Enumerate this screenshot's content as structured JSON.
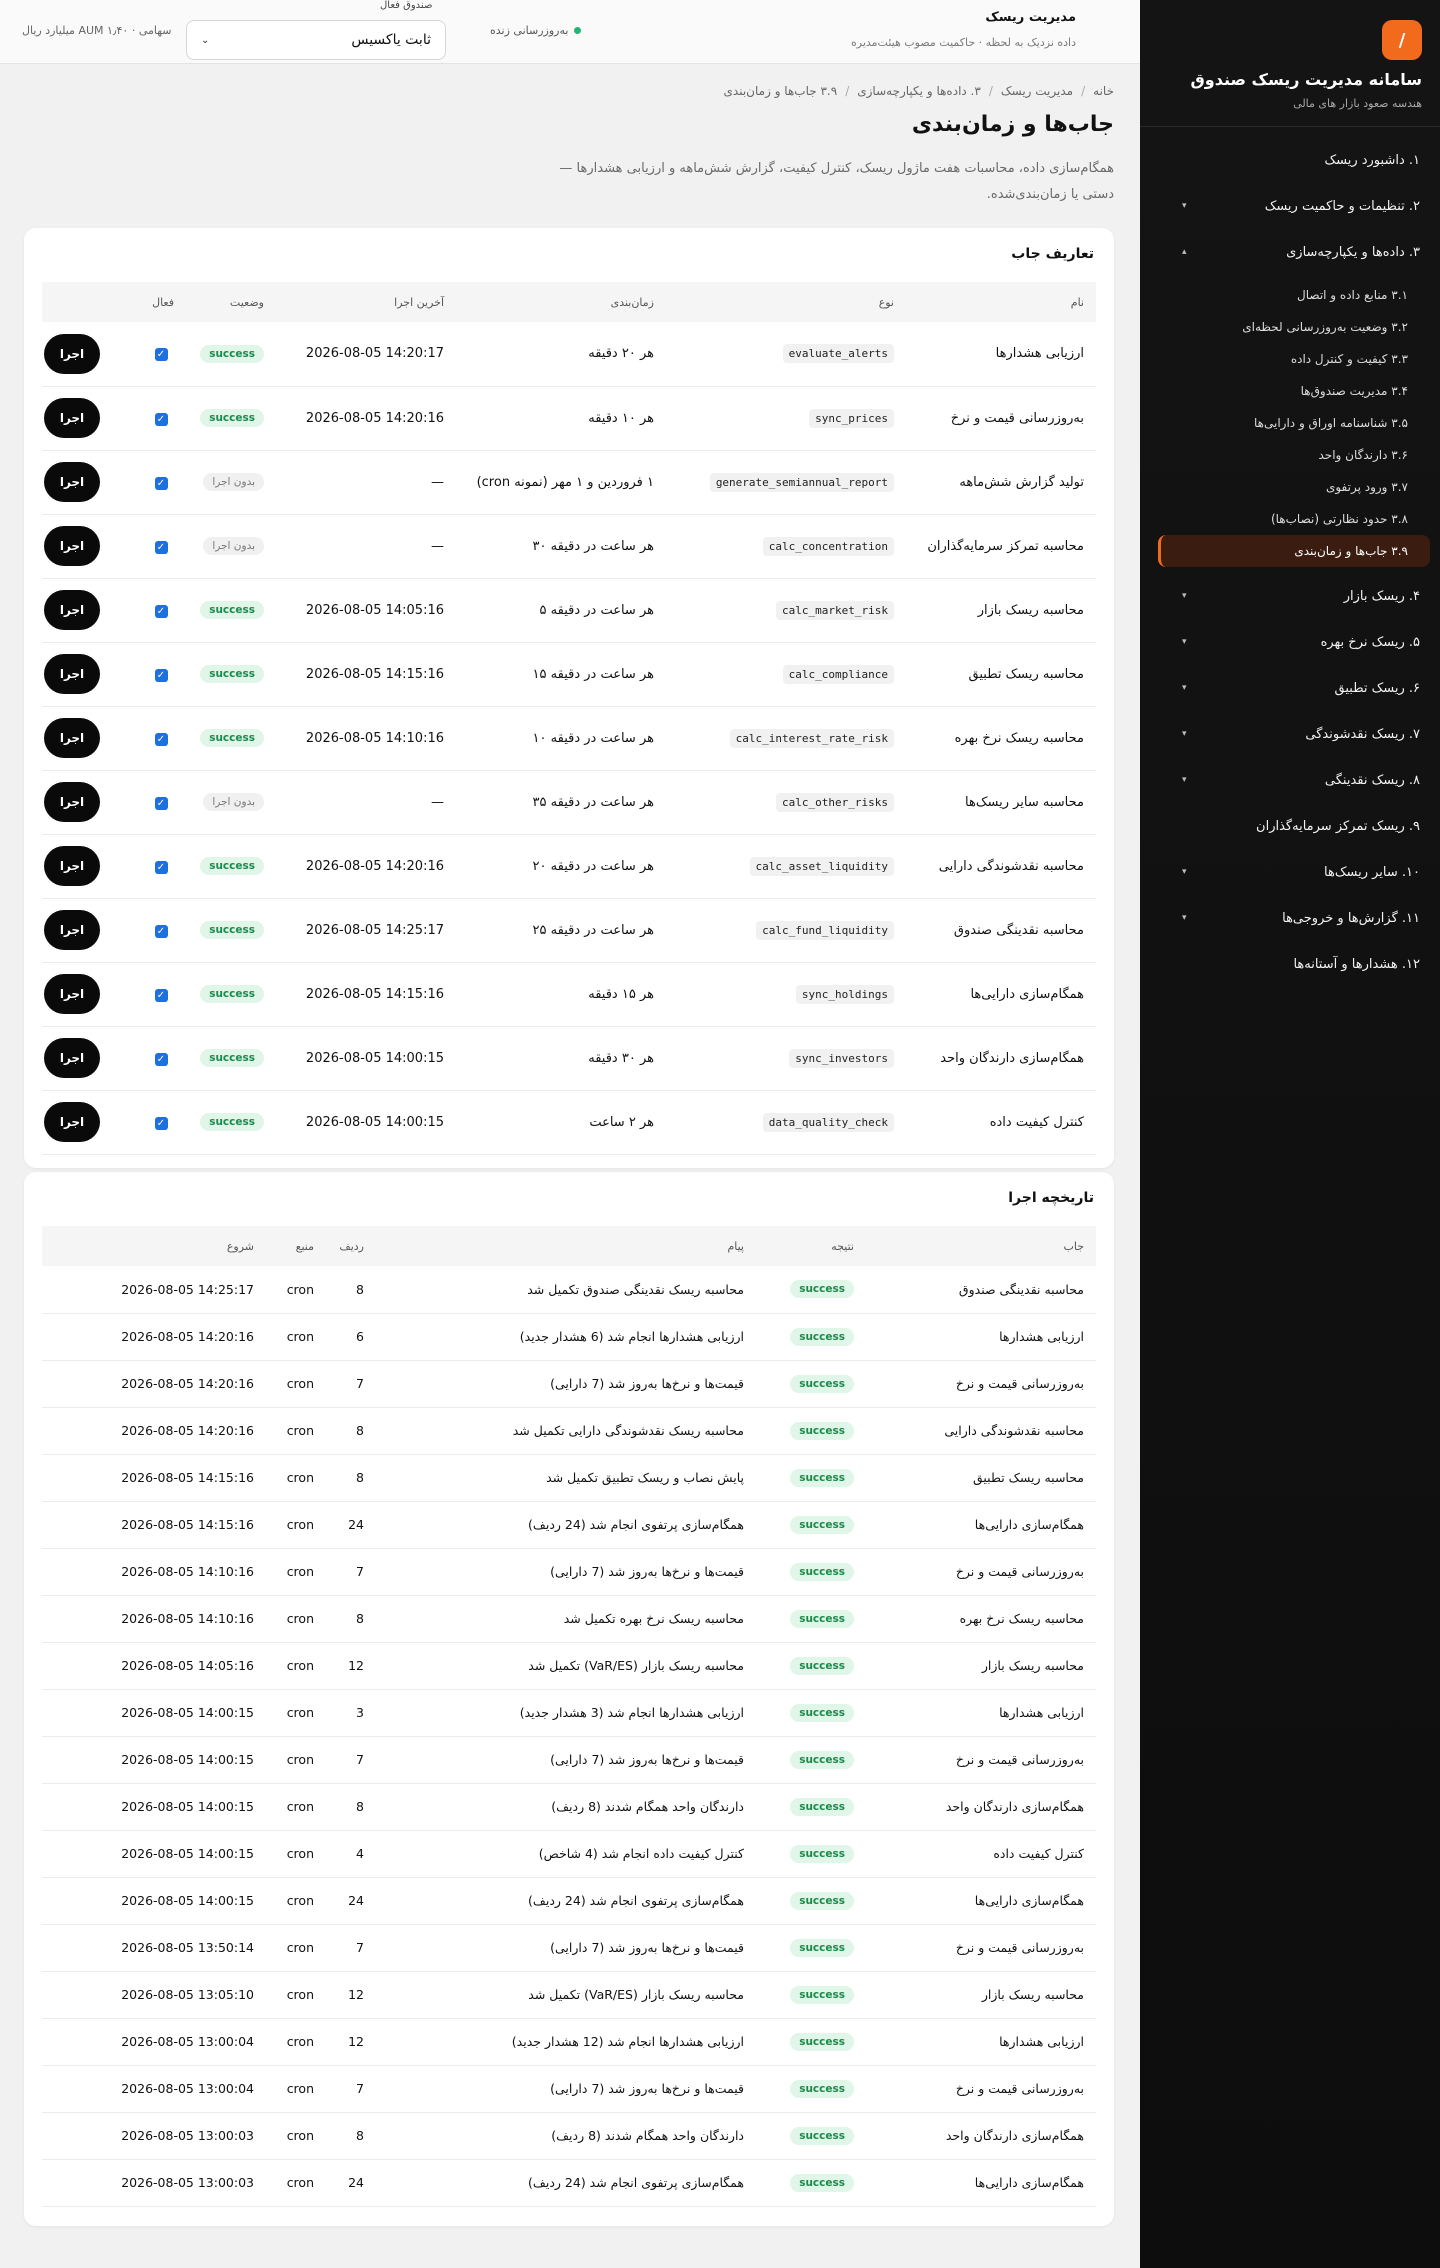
{
  "sidebar": {
    "logo": "/",
    "title": "سامانه مدیریت ریسک صندوق",
    "subtitle": "هندسه صعود بازار های مالی",
    "items": [
      {
        "label": "۱. داشبورد ریسک",
        "chevron": ""
      },
      {
        "label": "۲. تنظیمات و حاکمیت ریسک",
        "chevron": "▾"
      },
      {
        "label": "۳. داده‌ها و یکپارچه‌سازی",
        "chevron": "▴"
      },
      {
        "label": "۴. ریسک بازار",
        "chevron": "▾"
      },
      {
        "label": "۵. ریسک نرخ بهره",
        "chevron": "▾"
      },
      {
        "label": "۶. ریسک تطبیق",
        "chevron": "▾"
      },
      {
        "label": "۷. ریسک نقدشوندگی",
        "chevron": "▾"
      },
      {
        "label": "۸. ریسک نقدینگی",
        "chevron": "▾"
      },
      {
        "label": "۹. ریسک تمرکز سرمایه‌گذاران",
        "chevron": ""
      },
      {
        "label": "۱۰. سایر ریسک‌ها",
        "chevron": "▾"
      },
      {
        "label": "۱۱. گزارش‌ها و خروجی‌ها",
        "chevron": "▾"
      },
      {
        "label": "۱۲. هشدارها و آستانه‌ها",
        "chevron": ""
      }
    ],
    "subitems": [
      "۳.۱ منابع داده و اتصال",
      "۳.۲ وضعیت به‌روزرسانی لحظه‌ای",
      "۳.۳ کیفیت و کنترل داده",
      "۳.۴ مدیریت صندوق‌ها",
      "۳.۵ شناسنامه اوراق و دارایی‌ها",
      "۳.۶ دارندگان واحد",
      "۳.۷ ورود پرتفوی",
      "۳.۸ حدود نظارتی (نصاب‌ها)",
      "۳.۹ جاب‌ها و زمان‌بندی"
    ]
  },
  "topbar": {
    "title": "مدیریت ریسک",
    "subtitle": "داده نزدیک به لحظه · حاکمیت مصوب هیئت‌مدیره",
    "live": "به‌روزرسانی زنده",
    "fund_label": "صندوق فعال",
    "fund_value": "ثابت یاکسیس",
    "aum": "سهامی · AUM ۱٫۴۰ میلیارد ریال"
  },
  "breadcrumb": [
    "خانه",
    "مدیریت ریسک",
    "۳. داده‌ها و یکپارچه‌سازی",
    "۳.۹ جاب‌ها و زمان‌بندی"
  ],
  "page": {
    "title": "جاب‌ها و زمان‌بندی",
    "description": "همگام‌سازی داده، محاسبات هفت ماژول ریسک، کنترل کیفیت، گزارش شش‌ماهه و ارزیابی هشدارها — دستی یا زمان‌بندی‌شده."
  },
  "jobs": {
    "title": "تعاریف جاب",
    "columns": [
      "نام",
      "نوع",
      "زمان‌بندی",
      "آخرین اجرا",
      "وضعیت",
      "فعال"
    ],
    "run_label": "اجرا",
    "rows": [
      {
        "name": "ارزیابی هشدارها",
        "type": "evaluate_alerts",
        "schedule": "هر ۲۰ دقیقه",
        "last": "2026-08-05 14:20:17",
        "status": "success"
      },
      {
        "name": "به‌روزرسانی قیمت و نرخ",
        "type": "sync_prices",
        "schedule": "هر ۱۰ دقیقه",
        "last": "2026-08-05 14:20:16",
        "status": "success"
      },
      {
        "name": "تولید گزارش شش‌ماهه",
        "type": "generate_semiannual_report",
        "schedule": "۱ فروردین و ۱ مهر (نمونه cron)",
        "last": "—",
        "status": "بدون اجرا"
      },
      {
        "name": "محاسبه تمرکز سرمایه‌گذاران",
        "type": "calc_concentration",
        "schedule": "هر ساعت در دقیقه ۳۰",
        "last": "—",
        "status": "بدون اجرا"
      },
      {
        "name": "محاسبه ریسک بازار",
        "type": "calc_market_risk",
        "schedule": "هر ساعت در دقیقه ۵",
        "last": "2026-08-05 14:05:16",
        "status": "success"
      },
      {
        "name": "محاسبه ریسک تطبیق",
        "type": "calc_compliance",
        "schedule": "هر ساعت در دقیقه ۱۵",
        "last": "2026-08-05 14:15:16",
        "status": "success"
      },
      {
        "name": "محاسبه ریسک نرخ بهره",
        "type": "calc_interest_rate_risk",
        "schedule": "هر ساعت در دقیقه ۱۰",
        "last": "2026-08-05 14:10:16",
        "status": "success"
      },
      {
        "name": "محاسبه سایر ریسک‌ها",
        "type": "calc_other_risks",
        "schedule": "هر ساعت در دقیقه ۳۵",
        "last": "—",
        "status": "بدون اجرا"
      },
      {
        "name": "محاسبه نقدشوندگی دارایی",
        "type": "calc_asset_liquidity",
        "schedule": "هر ساعت در دقیقه ۲۰",
        "last": "2026-08-05 14:20:16",
        "status": "success"
      },
      {
        "name": "محاسبه نقدینگی صندوق",
        "type": "calc_fund_liquidity",
        "schedule": "هر ساعت در دقیقه ۲۵",
        "last": "2026-08-05 14:25:17",
        "status": "success"
      },
      {
        "name": "همگام‌سازی دارایی‌ها",
        "type": "sync_holdings",
        "schedule": "هر ۱۵ دقیقه",
        "last": "2026-08-05 14:15:16",
        "status": "success"
      },
      {
        "name": "همگام‌سازی دارندگان واحد",
        "type": "sync_investors",
        "schedule": "هر ۳۰ دقیقه",
        "last": "2026-08-05 14:00:15",
        "status": "success"
      },
      {
        "name": "کنترل کیفیت داده",
        "type": "data_quality_check",
        "schedule": "هر ۲ ساعت",
        "last": "2026-08-05 14:00:15",
        "status": "success"
      }
    ]
  },
  "history": {
    "title": "تاریخچه اجرا",
    "columns": [
      "جاب",
      "نتیجه",
      "پیام",
      "ردیف",
      "منبع",
      "شروع"
    ],
    "rows": [
      {
        "job": "محاسبه نقدینگی صندوق",
        "result": "success",
        "msg": "محاسبه ریسک نقدینگی صندوق تکمیل شد",
        "rows": "8",
        "src": "cron",
        "start": "2026-08-05 14:25:17"
      },
      {
        "job": "ارزیابی هشدارها",
        "result": "success",
        "msg": "ارزیابی هشدارها انجام شد (6 هشدار جدید)",
        "rows": "6",
        "src": "cron",
        "start": "2026-08-05 14:20:16"
      },
      {
        "job": "به‌روزرسانی قیمت و نرخ",
        "result": "success",
        "msg": "قیمت‌ها و نرخ‌ها به‌روز شد (7 دارایی)",
        "rows": "7",
        "src": "cron",
        "start": "2026-08-05 14:20:16"
      },
      {
        "job": "محاسبه نقدشوندگی دارایی",
        "result": "success",
        "msg": "محاسبه ریسک نقدشوندگی دارایی تکمیل شد",
        "rows": "8",
        "src": "cron",
        "start": "2026-08-05 14:20:16"
      },
      {
        "job": "محاسبه ریسک تطبیق",
        "result": "success",
        "msg": "پایش نصاب و ریسک تطبیق تکمیل شد",
        "rows": "8",
        "src": "cron",
        "start": "2026-08-05 14:15:16"
      },
      {
        "job": "همگام‌سازی دارایی‌ها",
        "result": "success",
        "msg": "همگام‌سازی پرتفوی انجام شد (24 ردیف)",
        "rows": "24",
        "src": "cron",
        "start": "2026-08-05 14:15:16"
      },
      {
        "job": "به‌روزرسانی قیمت و نرخ",
        "result": "success",
        "msg": "قیمت‌ها و نرخ‌ها به‌روز شد (7 دارایی)",
        "rows": "7",
        "src": "cron",
        "start": "2026-08-05 14:10:16"
      },
      {
        "job": "محاسبه ریسک نرخ بهره",
        "result": "success",
        "msg": "محاسبه ریسک نرخ بهره تکمیل شد",
        "rows": "8",
        "src": "cron",
        "start": "2026-08-05 14:10:16"
      },
      {
        "job": "محاسبه ریسک بازار",
        "result": "success",
        "msg": "محاسبه ریسک بازار (VaR/ES) تکمیل شد",
        "rows": "12",
        "src": "cron",
        "start": "2026-08-05 14:05:16"
      },
      {
        "job": "ارزیابی هشدارها",
        "result": "success",
        "msg": "ارزیابی هشدارها انجام شد (3 هشدار جدید)",
        "rows": "3",
        "src": "cron",
        "start": "2026-08-05 14:00:15"
      },
      {
        "job": "به‌روزرسانی قیمت و نرخ",
        "result": "success",
        "msg": "قیمت‌ها و نرخ‌ها به‌روز شد (7 دارایی)",
        "rows": "7",
        "src": "cron",
        "start": "2026-08-05 14:00:15"
      },
      {
        "job": "همگام‌سازی دارندگان واحد",
        "result": "success",
        "msg": "دارندگان واحد همگام شدند (8 ردیف)",
        "rows": "8",
        "src": "cron",
        "start": "2026-08-05 14:00:15"
      },
      {
        "job": "کنترل کیفیت داده",
        "result": "success",
        "msg": "کنترل کیفیت داده انجام شد (4 شاخص)",
        "rows": "4",
        "src": "cron",
        "start": "2026-08-05 14:00:15"
      },
      {
        "job": "همگام‌سازی دارایی‌ها",
        "result": "success",
        "msg": "همگام‌سازی پرتفوی انجام شد (24 ردیف)",
        "rows": "24",
        "src": "cron",
        "start": "2026-08-05 14:00:15"
      },
      {
        "job": "به‌روزرسانی قیمت و نرخ",
        "result": "success",
        "msg": "قیمت‌ها و نرخ‌ها به‌روز شد (7 دارایی)",
        "rows": "7",
        "src": "cron",
        "start": "2026-08-05 13:50:14"
      },
      {
        "job": "محاسبه ریسک بازار",
        "result": "success",
        "msg": "محاسبه ریسک بازار (VaR/ES) تکمیل شد",
        "rows": "12",
        "src": "cron",
        "start": "2026-08-05 13:05:10"
      },
      {
        "job": "ارزیابی هشدارها",
        "result": "success",
        "msg": "ارزیابی هشدارها انجام شد (12 هشدار جدید)",
        "rows": "12",
        "src": "cron",
        "start": "2026-08-05 13:00:04"
      },
      {
        "job": "به‌روزرسانی قیمت و نرخ",
        "result": "success",
        "msg": "قیمت‌ها و نرخ‌ها به‌روز شد (7 دارایی)",
        "rows": "7",
        "src": "cron",
        "start": "2026-08-05 13:00:04"
      },
      {
        "job": "همگام‌سازی دارندگان واحد",
        "result": "success",
        "msg": "دارندگان واحد همگام شدند (8 ردیف)",
        "rows": "8",
        "src": "cron",
        "start": "2026-08-05 13:00:03"
      },
      {
        "job": "همگام‌سازی دارایی‌ها",
        "result": "success",
        "msg": "همگام‌سازی پرتفوی انجام شد (24 ردیف)",
        "rows": "24",
        "src": "cron",
        "start": "2026-08-05 13:00:03"
      }
    ]
  },
  "colors": {
    "accent": "#f26a1b",
    "success_bg": "#dff6e8",
    "success_fg": "#1c8a4a",
    "sidebar_bg": "#111111"
  }
}
